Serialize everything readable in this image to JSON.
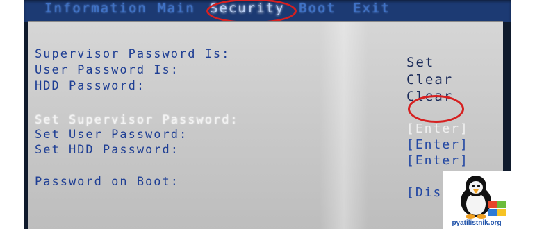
{
  "menu": {
    "items": [
      {
        "label": "Information"
      },
      {
        "label": "Main"
      },
      {
        "label": "Security"
      },
      {
        "label": "Boot"
      },
      {
        "label": "Exit"
      }
    ],
    "active": "Security"
  },
  "status": {
    "supervisor_password_label": "Supervisor Password Is:",
    "supervisor_password_value": "Set",
    "user_password_label": "User Password Is:",
    "user_password_value": "Clear",
    "hdd_password_label": "HDD Password:",
    "hdd_password_value": "Clear"
  },
  "actions": {
    "set_supervisor_label": "Set Supervisor Password:",
    "set_supervisor_value": "[Enter]",
    "set_user_label": "Set User Password:",
    "set_user_value": "[Enter]",
    "set_hdd_label": "Set HDD Password:",
    "set_hdd_value": "[Enter]",
    "password_on_boot_label": "Password on Boot:",
    "password_on_boot_value": "[Dis"
  },
  "watermark": {
    "site": "pyatilistnik.org"
  },
  "colors": {
    "highlight_ring": "#d62020",
    "menu_active": "#b8cff5",
    "label_blue": "#1e3e94"
  }
}
